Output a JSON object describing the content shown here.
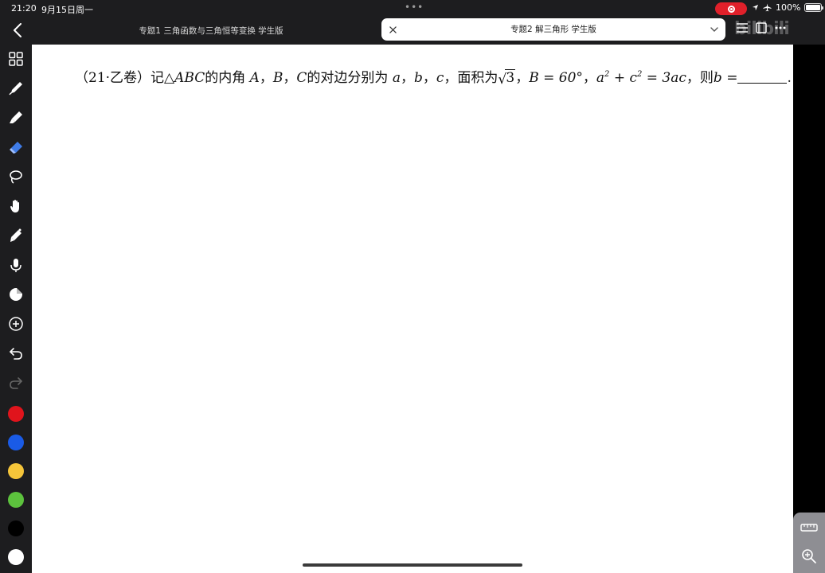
{
  "status": {
    "time": "21:20",
    "date": "9月15日周一",
    "battery": "100%"
  },
  "tabs": {
    "inactive_label": "专题1 三角函数与三角恒等变换 学生版",
    "active_label": "专题2 解三角形 学生版"
  },
  "watermark": "bilibili",
  "question": {
    "source": "（21·乙卷）",
    "text1": "记△",
    "var_abc": "ABC",
    "text2": "的内角",
    "var_a_up": "A",
    "comma": "，",
    "var_b_up": "B",
    "var_c_up": "C",
    "text3": "的对边分别为",
    "var_a": "a",
    "var_b": "b",
    "var_c": "c",
    "text4": "，面积为",
    "sqrt_value": "3",
    "cond1": "B = 60°",
    "cond2_lhs": "a",
    "cond2_mid": " + c",
    "cond2_rhs": " = 3ac",
    "exp": "2",
    "text5": "，则",
    "answer_var": "b",
    "eq": " =",
    "period": "."
  },
  "colors": {
    "red": "#e0141c",
    "blue": "#1a5be6",
    "yellow": "#f5c53a",
    "green": "#5cc23d",
    "black": "#000000",
    "white": "#ffffff"
  }
}
